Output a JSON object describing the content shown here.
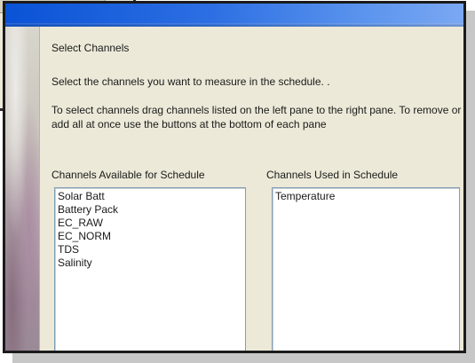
{
  "heading": "Select Channels",
  "instruction": "Select the channels you want to measure in the schedule. .",
  "help_text": "To select channels drag channels listed on the left pane to the right pane. To remove or add all at once use the buttons at the bottom of each pane",
  "available": {
    "label": "Channels Available for Schedule",
    "items": [
      "Solar Batt",
      "Battery Pack",
      "EC_RAW",
      "EC_NORM",
      "TDS",
      "Salinity"
    ]
  },
  "used": {
    "label": "Channels Used in Schedule",
    "items": [
      "Temperature"
    ]
  },
  "colors": {
    "titlebar_start": "#0a53d6",
    "titlebar_end": "#7ba8f2",
    "dialog_background": "#ece9d8",
    "list_border": "#7f9db9"
  }
}
